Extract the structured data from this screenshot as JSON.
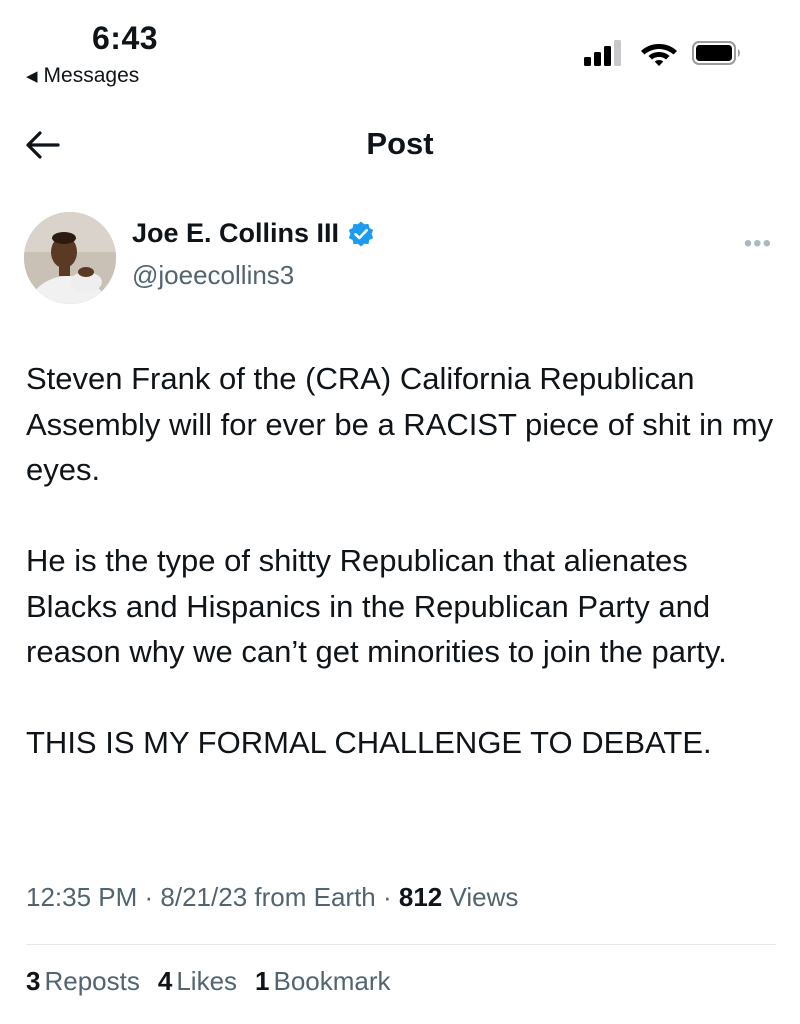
{
  "status_bar": {
    "time": "6:43",
    "back_app": "Messages",
    "icons": [
      "cellular-signal-icon",
      "wifi-icon",
      "battery-icon"
    ]
  },
  "nav": {
    "title": "Post",
    "back_icon": "arrow-left-icon"
  },
  "author": {
    "name": "Joe E. Collins III",
    "handle": "@joeecollins3",
    "verified": true,
    "verified_color": "#1d9bf0"
  },
  "post": {
    "paragraphs": [
      "Steven Frank of the (CRA) California Republican Assembly will for ever be a RACIST piece of shit in my eyes.",
      "He is the type of shitty Republican that alienates Blacks and Hispanics in the Republican Party and reason why we can’t get minorities to join the party.",
      "THIS IS MY FORMAL CHALLENGE TO DEBATE."
    ]
  },
  "meta": {
    "time": "12:35 PM",
    "sep1": " · ",
    "date": "8/21/23",
    "source": " from Earth",
    "sep2": " · ",
    "views_count": "812",
    "views_label": " Views"
  },
  "stats": {
    "reposts_count": "3",
    "reposts_label": "Reposts",
    "likes_count": "4",
    "likes_label": "Likes",
    "bookmarks_count": "1",
    "bookmarks_label": "Bookmark"
  },
  "colors": {
    "text": "#0f1419",
    "secondary": "#536471",
    "divider": "#e6e9eb"
  }
}
